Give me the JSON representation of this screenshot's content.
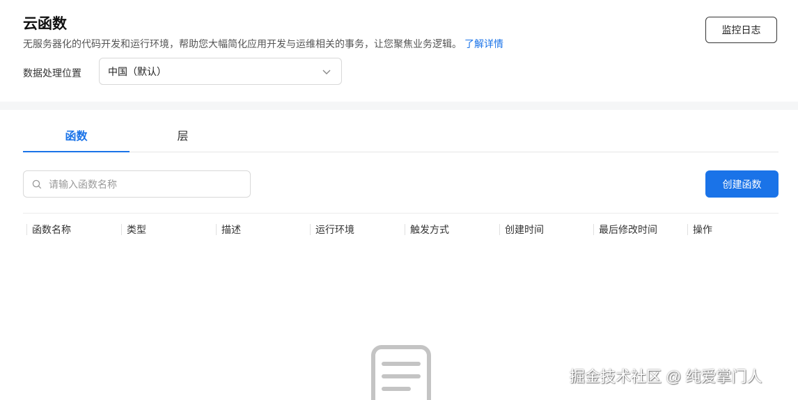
{
  "header": {
    "title": "云函数",
    "description": "无服务器化的代码开发和运行环境，帮助您大幅简化应用开发与运维相关的事务，让您聚焦业务逻辑。",
    "learn_more": "了解详情",
    "monitor_button": "监控日志",
    "region_label": "数据处理位置",
    "region_value": "中国（默认）"
  },
  "tabs": [
    {
      "label": "函数",
      "active": true
    },
    {
      "label": "层",
      "active": false
    }
  ],
  "toolbar": {
    "search_placeholder": "请输入函数名称",
    "create_button": "创建函数"
  },
  "table": {
    "columns": [
      "函数名称",
      "类型",
      "描述",
      "运行环境",
      "触发方式",
      "创建时间",
      "最后修改时间",
      "操作"
    ]
  },
  "watermark": "掘金技术社区 @ 纯爱掌门人",
  "colors": {
    "accent": "#1a73e8"
  }
}
